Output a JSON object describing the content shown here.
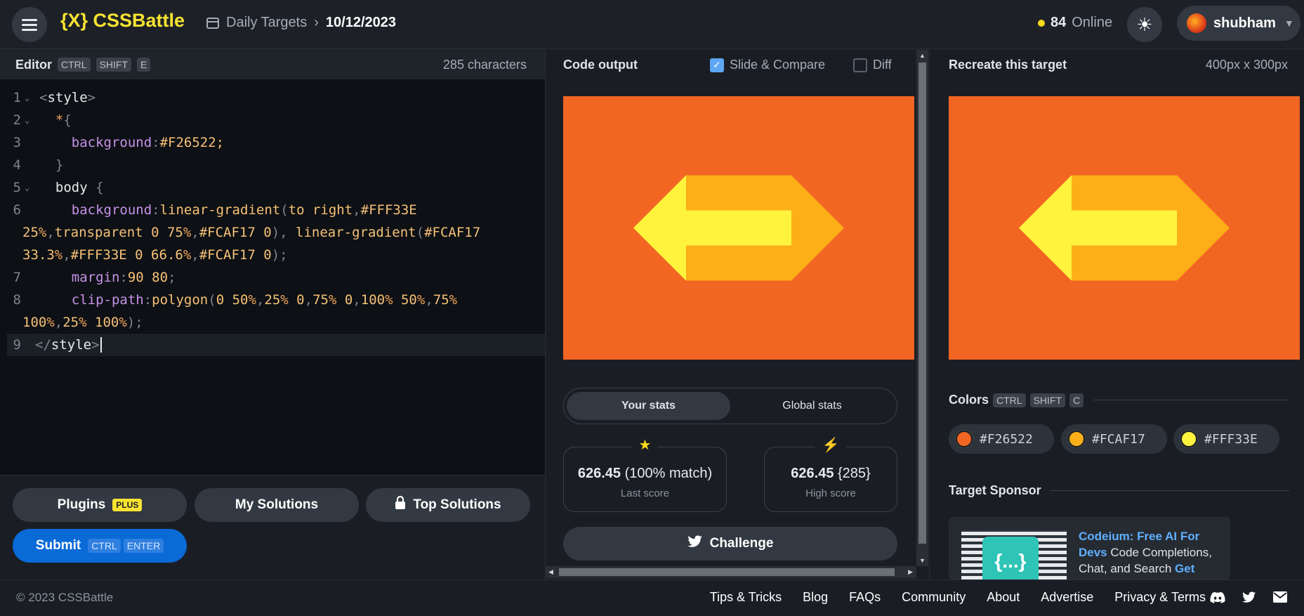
{
  "header": {
    "logo": "{X} CSSBattle",
    "breadcrumb_section": "Daily Targets",
    "breadcrumb_date": "10/12/2023",
    "online_count": "84",
    "online_label": "Online",
    "username": "shubham"
  },
  "editor": {
    "title": "Editor",
    "shortcut": [
      "CTRL",
      "SHIFT",
      "E"
    ],
    "char_count": "285 characters",
    "lines": [
      {
        "num": "1",
        "fold": true
      },
      {
        "num": "2",
        "fold": true
      },
      {
        "num": "3",
        "fold": false
      },
      {
        "num": "4",
        "fold": false
      },
      {
        "num": "5",
        "fold": true
      },
      {
        "num": "6",
        "fold": false
      },
      {
        "num": "",
        "fold": false
      },
      {
        "num": "",
        "fold": false
      },
      {
        "num": "7",
        "fold": false
      },
      {
        "num": "8",
        "fold": false
      },
      {
        "num": "",
        "fold": false
      },
      {
        "num": "9",
        "fold": false
      }
    ],
    "buttons": {
      "plugins": "Plugins",
      "plus_badge": "PLUS",
      "my_solutions": "My Solutions",
      "top_solutions": "Top Solutions",
      "submit": "Submit",
      "submit_shortcut": [
        "CTRL",
        "ENTER"
      ]
    }
  },
  "output": {
    "title": "Code output",
    "slide_compare": "Slide & Compare",
    "slide_compare_checked": true,
    "diff": "Diff",
    "diff_checked": false,
    "tabs": {
      "your_stats": "Your stats",
      "global_stats": "Global stats"
    },
    "last_score_value": "626.45",
    "last_score_match": "(100% match)",
    "last_score_label": "Last score",
    "high_score_value": "626.45",
    "high_score_chars": "{285}",
    "high_score_label": "High score",
    "challenge": "Challenge"
  },
  "target": {
    "title": "Recreate this target",
    "dimensions": "400px x 300px",
    "colors_title": "Colors",
    "colors_shortcut": [
      "CTRL",
      "SHIFT",
      "C"
    ],
    "colors": [
      {
        "hex": "#F26522",
        "label": "#F26522"
      },
      {
        "hex": "#FCAF17",
        "label": "#FCAF17"
      },
      {
        "hex": "#FFF33E",
        "label": "#FFF33E"
      }
    ],
    "sponsor_title": "Target Sponsor",
    "sponsor_headline": "Codeium: Free AI For Devs",
    "sponsor_body": " Code Completions, Chat, and Search ",
    "sponsor_cta": "Get",
    "sponsor_logo_text": "{...}"
  },
  "footer": {
    "copyright": "© 2023 CSSBattle",
    "links": [
      "Tips & Tricks",
      "Blog",
      "FAQs",
      "Community",
      "About",
      "Advertise",
      "Privacy & Terms"
    ]
  },
  "colors": {
    "background": "#F26522",
    "gold": "#FCAF17",
    "yellow": "#FFF33E",
    "accent_blue": "#0A6AD6"
  }
}
